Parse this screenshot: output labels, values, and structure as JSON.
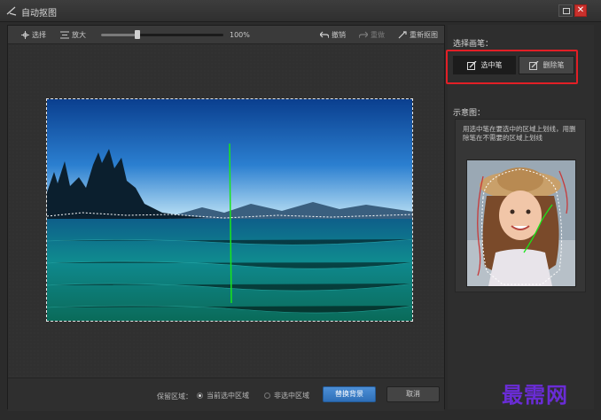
{
  "window": {
    "title": "自动抠图",
    "icons": {
      "app": "scissors-icon",
      "maximize": "maximize-icon",
      "close": "close-icon"
    }
  },
  "toolbar": {
    "move_label": "选择",
    "zoom_label": "放大",
    "zoom_value": "100%",
    "zoom_fraction": 0.3,
    "undo_label": "撤销",
    "redo_label": "重做",
    "reset_label": "重新抠图"
  },
  "bottom": {
    "keep_label": "保留区域：",
    "option_current": "当前选中区域",
    "option_other": "非选中区域",
    "selected_option": "当前选中区域",
    "replace_label": "替换背景",
    "cancel_label": "取消"
  },
  "side": {
    "choose_brush_title": "选择画笔：",
    "brush_select_label": "选中笔",
    "brush_erase_label": "删除笔",
    "demo_title": "示意图：",
    "demo_desc": "用选中笔在要选中的区域上划线，用删除笔在不需要的区域上划线"
  },
  "watermark": "最需网",
  "colors": {
    "accent_blue": "#2e6fb8",
    "highlight_red": "#e21f26",
    "select_stroke_green": "#19e619",
    "erase_stroke_red": "#c73a3a",
    "watermark_purple": "#6a2cd6"
  }
}
